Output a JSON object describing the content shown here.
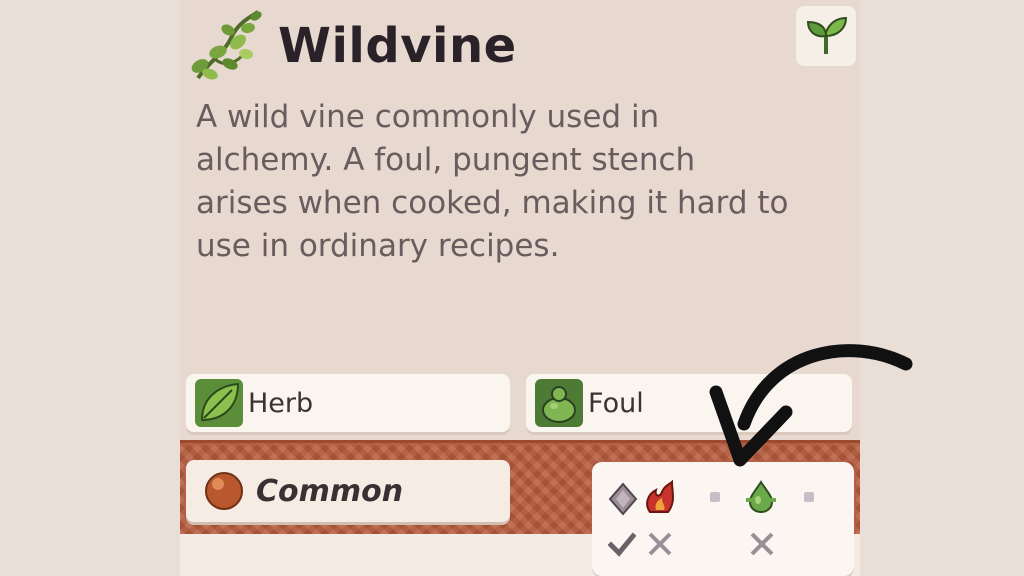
{
  "item": {
    "name": "Wildvine",
    "icon": "vine-icon",
    "category_icon": "sprout-icon",
    "description": "A wild vine commonly used in alchemy. A foul, pungent stench arises when cooked, making it hard to use in ordinary recipes.",
    "tags": [
      {
        "label": "Herb",
        "icon": "leaf-icon"
      },
      {
        "label": "Foul",
        "icon": "foul-blob-icon"
      }
    ],
    "rarity": {
      "label": "Common",
      "icon": "bronze-orb-icon"
    }
  },
  "properties": {
    "icons": [
      "gray-diamond-icon",
      "red-flame-icon",
      "dot-icon",
      "green-drop-icon",
      "dot-icon"
    ],
    "marks": [
      "check",
      "cross",
      "cross"
    ]
  },
  "colors": {
    "background": "#eadfd6",
    "card": "#e7d9cf",
    "strip": "#b65a3c",
    "tag_bg": "#fbf5ef"
  }
}
